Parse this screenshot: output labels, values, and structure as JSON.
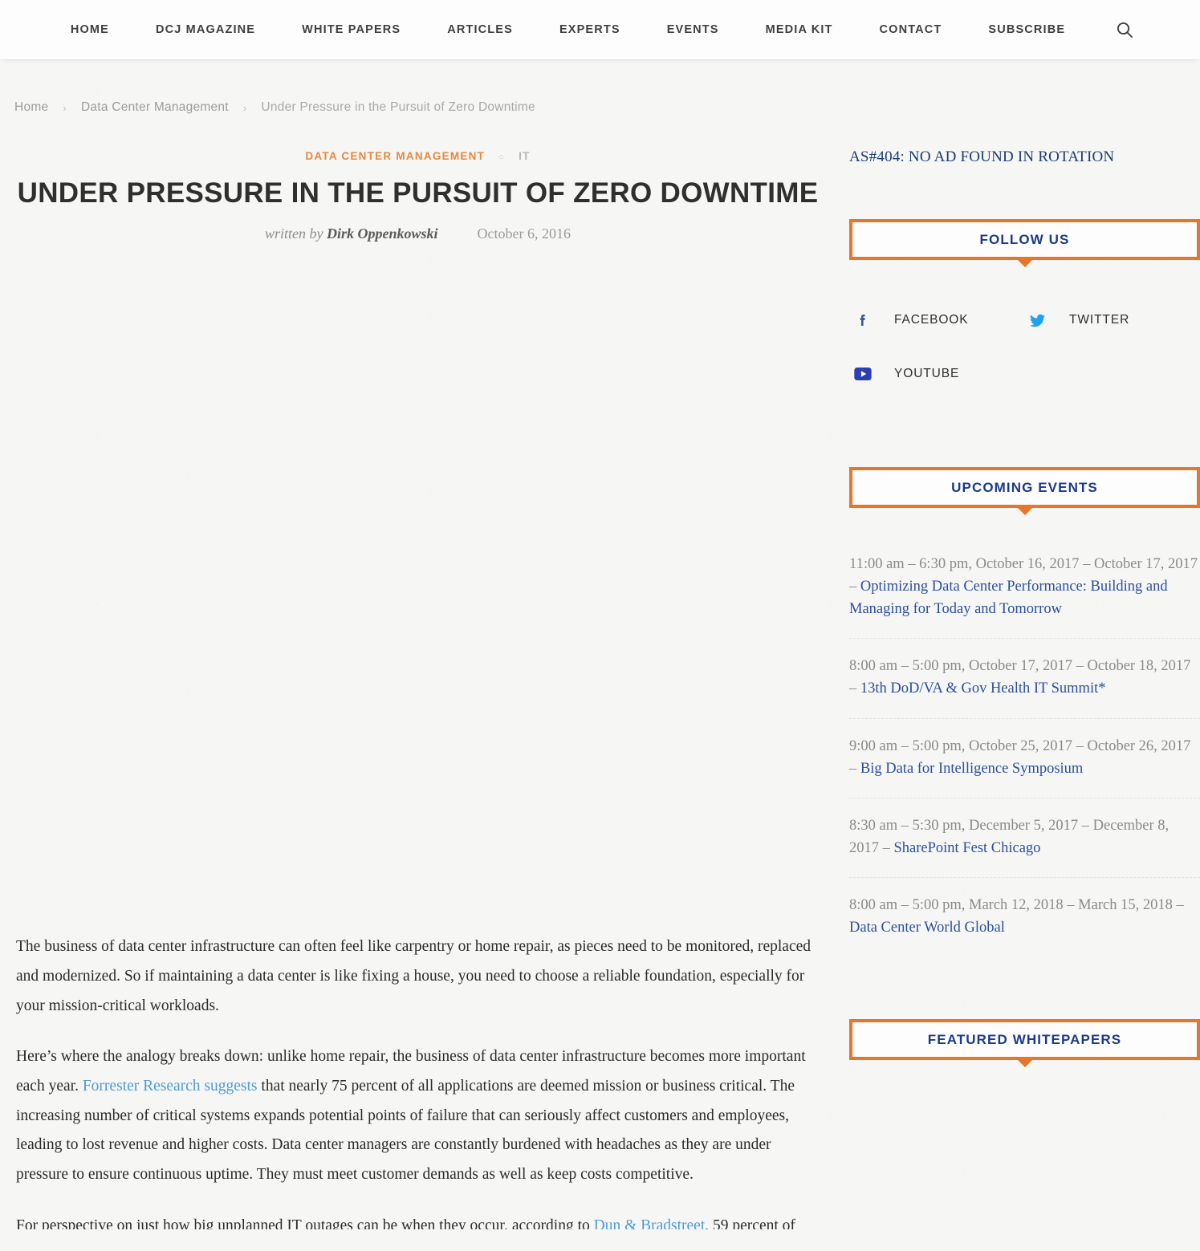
{
  "nav": {
    "items": [
      {
        "label": "HOME",
        "name": "nav-home"
      },
      {
        "label": "DCJ MAGAZINE",
        "name": "nav-dcj-magazine"
      },
      {
        "label": "WHITE PAPERS",
        "name": "nav-white-papers"
      },
      {
        "label": "ARTICLES",
        "name": "nav-articles"
      },
      {
        "label": "EXPERTS",
        "name": "nav-experts"
      },
      {
        "label": "EVENTS",
        "name": "nav-events"
      },
      {
        "label": "MEDIA KIT",
        "name": "nav-media-kit"
      },
      {
        "label": "CONTACT",
        "name": "nav-contact"
      },
      {
        "label": "SUBSCRIBE",
        "name": "nav-subscribe"
      }
    ],
    "search_icon": "search-icon"
  },
  "breadcrumb": {
    "home": "Home",
    "separator": "›",
    "category": "Data Center Management",
    "current": "Under Pressure in the Pursuit of Zero Downtime"
  },
  "article": {
    "category_primary": "DATA CENTER MANAGEMENT",
    "category_divider": "○",
    "category_secondary": "IT",
    "title": "UNDER PRESSURE IN THE PURSUIT OF ZERO DOWNTIME",
    "written_by_label": "written by",
    "author": "Dirk Oppenkowski",
    "date": "October 6, 2016",
    "paragraphs": [
      {
        "parts": [
          {
            "t": "The business of data center infrastructure can often feel like carpentry or home repair, as pieces need to be monitored, replaced and modernized. So if maintaining a data center is like fixing a house, you need to choose a reliable foundation, especially for your mission-critical workloads.",
            "link": false
          }
        ]
      },
      {
        "parts": [
          {
            "t": "Here’s where the analogy breaks down: unlike home repair, the business of data center infrastructure becomes more important each year. ",
            "link": false
          },
          {
            "t": "Forrester Research suggests",
            "link": true
          },
          {
            "t": " that nearly 75 percent of all applications are deemed mission or business critical. The increasing number of critical systems expands potential points of failure that can seriously affect customers and employees, leading to lost revenue and higher costs. Data center managers are constantly burdened with headaches as they are under pressure to ensure continuous uptime. They must meet customer demands as well as keep costs competitive.",
            "link": false
          }
        ]
      },
      {
        "cut": true,
        "parts": [
          {
            "t": "For perspective on just how big unplanned IT outages can be when they occur, according to ",
            "link": false
          },
          {
            "t": "Dun & Bradstreet",
            "link": true
          },
          {
            "t": ", 59 percent of",
            "link": false
          }
        ]
      }
    ]
  },
  "sidebar": {
    "ad_notice": "AS#404: NO AD FOUND IN ROTATION",
    "follow_us": {
      "heading": "FOLLOW US",
      "links": [
        {
          "label": "FACEBOOK",
          "icon": "facebook-icon",
          "color": "#3b5998"
        },
        {
          "label": "TWITTER",
          "icon": "twitter-icon",
          "color": "#1da1f2"
        },
        {
          "label": "YOUTUBE",
          "icon": "youtube-icon",
          "color": "#2b3fb5"
        }
      ]
    },
    "upcoming_events": {
      "heading": "UPCOMING EVENTS",
      "items": [
        {
          "when": "11:00 am – 6:30 pm, October 16, 2017 – October 17, 2017 – ",
          "title": "Optimizing Data Center Performance: Building and Managing for Today and Tomorrow"
        },
        {
          "when": "8:00 am – 5:00 pm, October 17, 2017 – October 18, 2017 – ",
          "title": "13th DoD/VA & Gov Health IT Summit*"
        },
        {
          "when": "9:00 am – 5:00 pm, October 25, 2017 – October 26, 2017 – ",
          "title": "Big Data for Intelligence Symposium"
        },
        {
          "when": "8:30 am – 5:30 pm, December 5, 2017 – December 8, 2017 – ",
          "title": "SharePoint Fest Chicago"
        },
        {
          "when": "8:00 am – 5:00 pm, March 12, 2018 – March 15, 2018 – ",
          "title": "Data Center World Global"
        }
      ]
    },
    "featured_whitepapers": {
      "heading": "FEATURED WHITEPAPERS"
    }
  },
  "colors": {
    "accent_orange": "#e8762a",
    "category_orange": "#e8873a",
    "heading_blue": "#1b3a8a",
    "link_blue": "#2b4f9e",
    "body_link_blue": "#4f9bd6",
    "page_bg": "#f6f6f5"
  }
}
